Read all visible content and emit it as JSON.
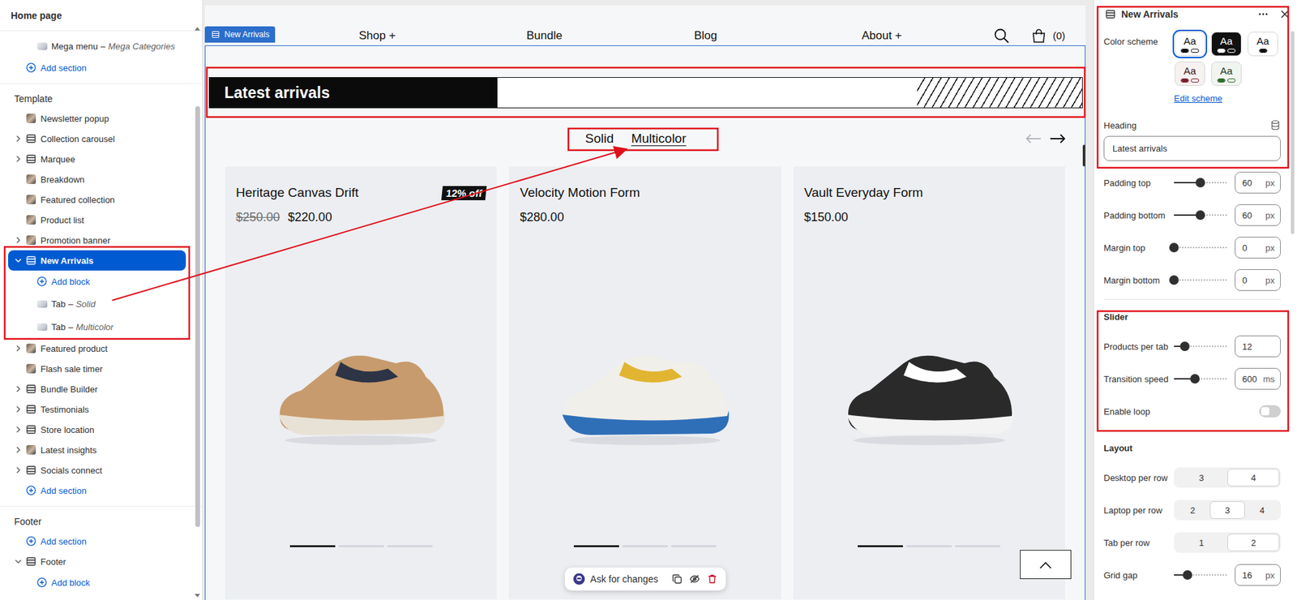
{
  "sidebar": {
    "title": "Home page",
    "top_items": [
      {
        "kind": "block",
        "label": "Mega menu",
        "sep": "–",
        "sub": "Mega Categories",
        "expandable": false,
        "expanded": false,
        "selected": false
      },
      {
        "kind": "add",
        "label": "Add section",
        "expandable": false,
        "expanded": false,
        "selected": false
      }
    ],
    "groups": [
      {
        "title": "Template",
        "items": [
          {
            "kind": "media",
            "label": "Newsletter popup",
            "expandable": false,
            "expanded": false,
            "selected": false
          },
          {
            "kind": "section",
            "label": "Collection carousel",
            "expandable": true,
            "expanded": false,
            "selected": false
          },
          {
            "kind": "section",
            "label": "Marquee",
            "expandable": true,
            "expanded": false,
            "selected": false
          },
          {
            "kind": "media",
            "label": "Breakdown",
            "expandable": false,
            "expanded": false,
            "selected": false
          },
          {
            "kind": "media",
            "label": "Featured collection",
            "expandable": false,
            "expanded": false,
            "selected": false
          },
          {
            "kind": "media",
            "label": "Product list",
            "expandable": false,
            "expanded": false,
            "selected": false
          },
          {
            "kind": "media",
            "label": "Promotion banner",
            "expandable": true,
            "expanded": false,
            "selected": false
          },
          {
            "kind": "section",
            "label": "New Arrivals",
            "expandable": true,
            "expanded": true,
            "selected": true
          },
          {
            "kind": "add-block",
            "label": "Add block",
            "expandable": false,
            "expanded": false,
            "selected": false
          },
          {
            "kind": "block",
            "label": "Tab",
            "sep": "–",
            "sub": "Solid",
            "expandable": false,
            "expanded": false,
            "selected": false
          },
          {
            "kind": "block",
            "label": "Tab",
            "sep": "–",
            "sub": "Multicolor",
            "expandable": false,
            "expanded": false,
            "selected": false
          },
          {
            "kind": "media",
            "label": "Featured product",
            "expandable": true,
            "expanded": false,
            "selected": false
          },
          {
            "kind": "media",
            "label": "Flash sale timer",
            "expandable": false,
            "expanded": false,
            "selected": false
          },
          {
            "kind": "section",
            "label": "Bundle Builder",
            "expandable": true,
            "expanded": false,
            "selected": false
          },
          {
            "kind": "section",
            "label": "Testimonials",
            "expandable": true,
            "expanded": false,
            "selected": false
          },
          {
            "kind": "section",
            "label": "Store location",
            "expandable": true,
            "expanded": false,
            "selected": false
          },
          {
            "kind": "media",
            "label": "Latest insights",
            "expandable": true,
            "expanded": false,
            "selected": false
          },
          {
            "kind": "section",
            "label": "Socials connect",
            "expandable": true,
            "expanded": false,
            "selected": false
          },
          {
            "kind": "add",
            "label": "Add section",
            "expandable": false,
            "expanded": false,
            "selected": false
          }
        ]
      },
      {
        "title": "Footer",
        "items": [
          {
            "kind": "add",
            "label": "Add section",
            "expandable": false,
            "expanded": false,
            "selected": false
          },
          {
            "kind": "section",
            "label": "Footer",
            "expandable": true,
            "expanded": true,
            "selected": false
          },
          {
            "kind": "add-block",
            "label": "Add block",
            "expandable": false,
            "expanded": false,
            "selected": false
          }
        ]
      }
    ]
  },
  "preview": {
    "section_tag": "New Arrivals",
    "nav": [
      "Shop +",
      "Bundle",
      "Blog",
      "About +"
    ],
    "cart_count": "(0)",
    "heading": "Latest arrivals",
    "tabs": [
      {
        "label": "Solid",
        "selected": false
      },
      {
        "label": "Multicolor",
        "selected": true
      }
    ],
    "prev_disabled": true,
    "next_disabled": false,
    "products": [
      {
        "title": "Heritage Canvas Drift",
        "compare_price": "$250.00",
        "price": "$220.00",
        "badge": "12% off",
        "slides": [
          {
            "selected": true
          },
          {
            "selected": false
          },
          {
            "selected": false
          }
        ]
      },
      {
        "title": "Velocity Motion Form",
        "price": "$280.00",
        "slides": [
          {
            "selected": true
          },
          {
            "selected": false
          },
          {
            "selected": false
          }
        ]
      },
      {
        "title": "Vault Everyday Form",
        "price": "$150.00",
        "slides": [
          {
            "selected": true
          },
          {
            "selected": false
          },
          {
            "selected": false
          }
        ]
      }
    ],
    "toolbar": {
      "ask": "Ask for changes"
    }
  },
  "settings": {
    "title": "New Arrivals",
    "color_scheme": {
      "label": "Color scheme",
      "edit": "Edit scheme",
      "swatches": [
        {
          "label": "Aa",
          "selected": true,
          "color": "#ffffff",
          "text_color": "#111111",
          "dots": [
            {
              "color": "#111111",
              "filled": true
            },
            {
              "color": "#111111",
              "filled": false
            }
          ]
        },
        {
          "label": "Aa",
          "selected": false,
          "color": "#111111",
          "text_color": "#ffffff",
          "dots": [
            {
              "color": "#ffffff",
              "filled": true
            },
            {
              "color": "#ffffff",
              "filled": false
            }
          ]
        },
        {
          "label": "Aa",
          "selected": false,
          "color": "#ffffff",
          "text_color": "#111111",
          "dots": [
            {
              "color": "#111111",
              "filled": true
            }
          ]
        },
        {
          "label": "Aa",
          "selected": false,
          "color": "#f7f1f1",
          "text_color": "#3a1a1e",
          "dots": [
            {
              "color": "#7b1e2c",
              "filled": true
            },
            {
              "color": "#7b1e2c",
              "filled": false
            }
          ]
        },
        {
          "label": "Aa",
          "selected": false,
          "color": "#f1f5f0",
          "text_color": "#1f3a1f",
          "dots": [
            {
              "color": "#2f6b2f",
              "filled": true
            },
            {
              "color": "#2f6b2f",
              "filled": false
            }
          ]
        }
      ]
    },
    "heading": {
      "label": "Heading",
      "value": "Latest arrivals"
    },
    "spacing": [
      {
        "kind": "slider",
        "label": "Padding top",
        "value": "60",
        "unit": "px",
        "level": 0.5
      },
      {
        "kind": "slider",
        "label": "Padding bottom",
        "value": "60",
        "unit": "px",
        "level": 0.5
      },
      {
        "kind": "slider",
        "label": "Margin top",
        "value": "0",
        "unit": "px",
        "level": 0
      },
      {
        "kind": "slider",
        "label": "Margin bottom",
        "value": "0",
        "unit": "px",
        "level": 0
      }
    ],
    "sections": [
      {
        "title": "Slider",
        "rows": [
          {
            "kind": "slider",
            "label": "Products per tab",
            "value": "12",
            "level": 0.2
          },
          {
            "kind": "slider",
            "label": "Transition speed",
            "value": "600",
            "unit": "ms",
            "level": 0.4
          },
          {
            "kind": "toggle",
            "label": "Enable loop",
            "on": false
          }
        ]
      },
      {
        "title": "Layout",
        "rows": [
          {
            "kind": "segmented",
            "label": "Desktop per row",
            "options": [
              {
                "label": "3",
                "selected": false
              },
              {
                "label": "4",
                "selected": true
              }
            ]
          },
          {
            "kind": "segmented",
            "label": "Laptop per row",
            "options": [
              {
                "label": "2",
                "selected": false
              },
              {
                "label": "3",
                "selected": true
              },
              {
                "label": "4",
                "selected": false
              }
            ]
          },
          {
            "kind": "segmented",
            "label": "Tab per row",
            "options": [
              {
                "label": "1",
                "selected": false
              },
              {
                "label": "2",
                "selected": true
              }
            ]
          },
          {
            "kind": "slider",
            "label": "Grid gap",
            "value": "16",
            "unit": "px",
            "level": 0.25
          }
        ]
      }
    ]
  }
}
